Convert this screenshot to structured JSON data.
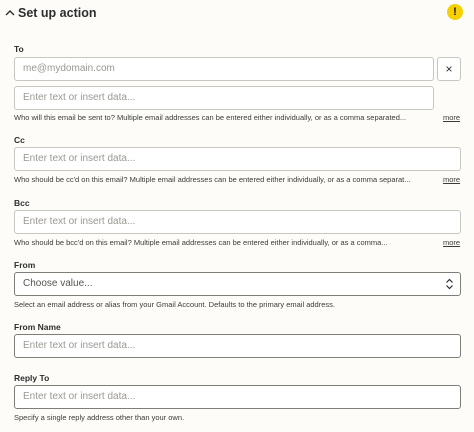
{
  "header": {
    "title": "Set up action",
    "alert": "!"
  },
  "to": {
    "label": "To",
    "value_placeholder": "me@mydomain.com",
    "clear_icon": "×",
    "insert_placeholder": "Enter text or insert data...",
    "help": "Who will this email be sent to? Multiple email addresses can be entered either individually, or as a comma separated...",
    "more": "more"
  },
  "cc": {
    "label": "Cc",
    "placeholder": "Enter text or insert data...",
    "help": "Who should be cc'd on this email? Multiple email addresses can be entered either individually, or as a comma separat...",
    "more": "more"
  },
  "bcc": {
    "label": "Bcc",
    "placeholder": "Enter text or insert data...",
    "help": "Who should be bcc'd on this email? Multiple email addresses can be entered either individually, or as a comma...",
    "more": "more"
  },
  "from": {
    "label": "From",
    "placeholder": "Choose value...",
    "help": "Select an email address or alias from your Gmail Account. Defaults to the primary email address."
  },
  "from_name": {
    "label": "From Name",
    "placeholder": "Enter text or insert data..."
  },
  "reply_to": {
    "label": "Reply To",
    "placeholder": "Enter text or insert data...",
    "help": "Specify a single reply address other than your own."
  }
}
